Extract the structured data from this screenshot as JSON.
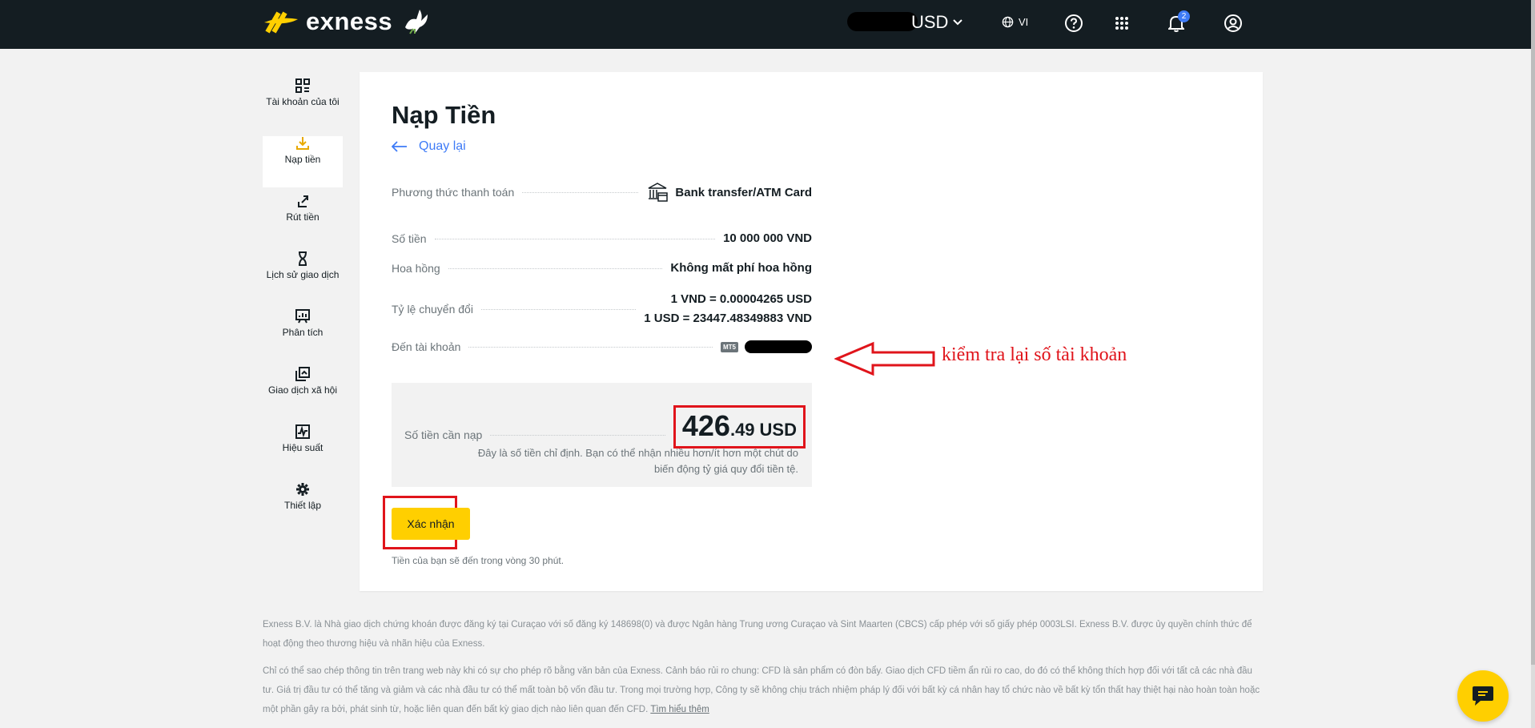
{
  "header": {
    "brand": "exness",
    "currency": "USD",
    "language": "VI",
    "notification_count": "2"
  },
  "sidebar": {
    "items": [
      {
        "label": "Tài khoản của tôi",
        "icon": "accounts-grid-icon"
      },
      {
        "label": "Nạp tiền",
        "icon": "deposit-download-icon",
        "active": true
      },
      {
        "label": "Rút tiền",
        "icon": "withdraw-upload-icon"
      },
      {
        "label": "Lịch sử giao dịch",
        "icon": "hourglass-icon"
      },
      {
        "label": "Phân tích",
        "icon": "analytics-board-icon"
      },
      {
        "label": "Giao dịch xã hội",
        "icon": "social-trading-icon"
      },
      {
        "label": "Hiệu suất",
        "icon": "performance-chart-icon"
      },
      {
        "label": "Thiết lập",
        "icon": "gear-icon"
      }
    ]
  },
  "main": {
    "title": "Nạp Tiền",
    "back_label": "Quay lại",
    "payment_method": {
      "label": "Phương thức thanh toán",
      "value": "Bank transfer/ATM Card"
    },
    "amount": {
      "label": "Số tiền",
      "value": "10 000 000 VND"
    },
    "commission": {
      "label": "Hoa hồng",
      "value": "Không mất phí hoa hồng"
    },
    "rate": {
      "label": "Tỷ lệ chuyển đổi",
      "line1": "1 VND = 0.00004265 USD",
      "line2": "1 USD = 23447.48349883 VND"
    },
    "to_account": {
      "label": "Đến tài khoản",
      "platform": "MT5"
    },
    "summary": {
      "label": "Số tiền cần nạp",
      "amount_int": "426",
      "amount_dec": ".49",
      "currency": "USD",
      "note_line1": "Đây là số tiền chỉ định. Bạn có thể nhận nhiều hơn/ít hơn một chút do",
      "note_line2": "biến động tỷ giá quy đổi tiền tệ."
    },
    "confirm_label": "Xác nhận",
    "arrival_note": "Tiền của bạn sẽ đến trong vòng 30 phút."
  },
  "annotation": {
    "text": "kiểm tra lại số tài khoản",
    "color": "#e0141b"
  },
  "footer": {
    "para1": "Exness B.V. là Nhà giao dịch chứng khoán được đăng ký tại Curaçao với số đăng ký 148698(0) và được Ngân hàng Trung ương Curaçao và Sint Maarten (CBCS) cấp phép với số giấy phép 0003LSI. Exness B.V. được ủy quyền chính thức để hoạt động theo thương hiệu và nhãn hiệu của Exness.",
    "para2": "Chỉ có thể sao chép thông tin trên trang web này khi có sự cho phép rõ bằng văn bản của Exness. Cảnh báo rủi ro chung: CFD là sản phẩm có đòn bẩy. Giao dịch CFD tiềm ẩn rủi ro cao, do đó có thể không thích hợp đối với tất cả các nhà đầu tư. Giá trị đầu tư có thể tăng và giảm và các nhà đầu tư có thể mất toàn bộ vốn đầu tư. Trong mọi trường hợp, Công ty sẽ không chịu trách nhiệm pháp lý đối với bất kỳ cá nhân hay tổ chức nào về bất kỳ tổn thất hay thiệt hại nào hoàn toàn hoặc một phần gây ra bởi, phát sinh từ, hoặc liên quan đến bất kỳ giao dịch nào liên quan đến CFD.",
    "learn_more": "Tìm hiểu thêm"
  },
  "colors": {
    "accent": "#ffcf00",
    "topbar": "#141d22",
    "link": "#3e7bf7",
    "highlight": "#e0141b"
  }
}
